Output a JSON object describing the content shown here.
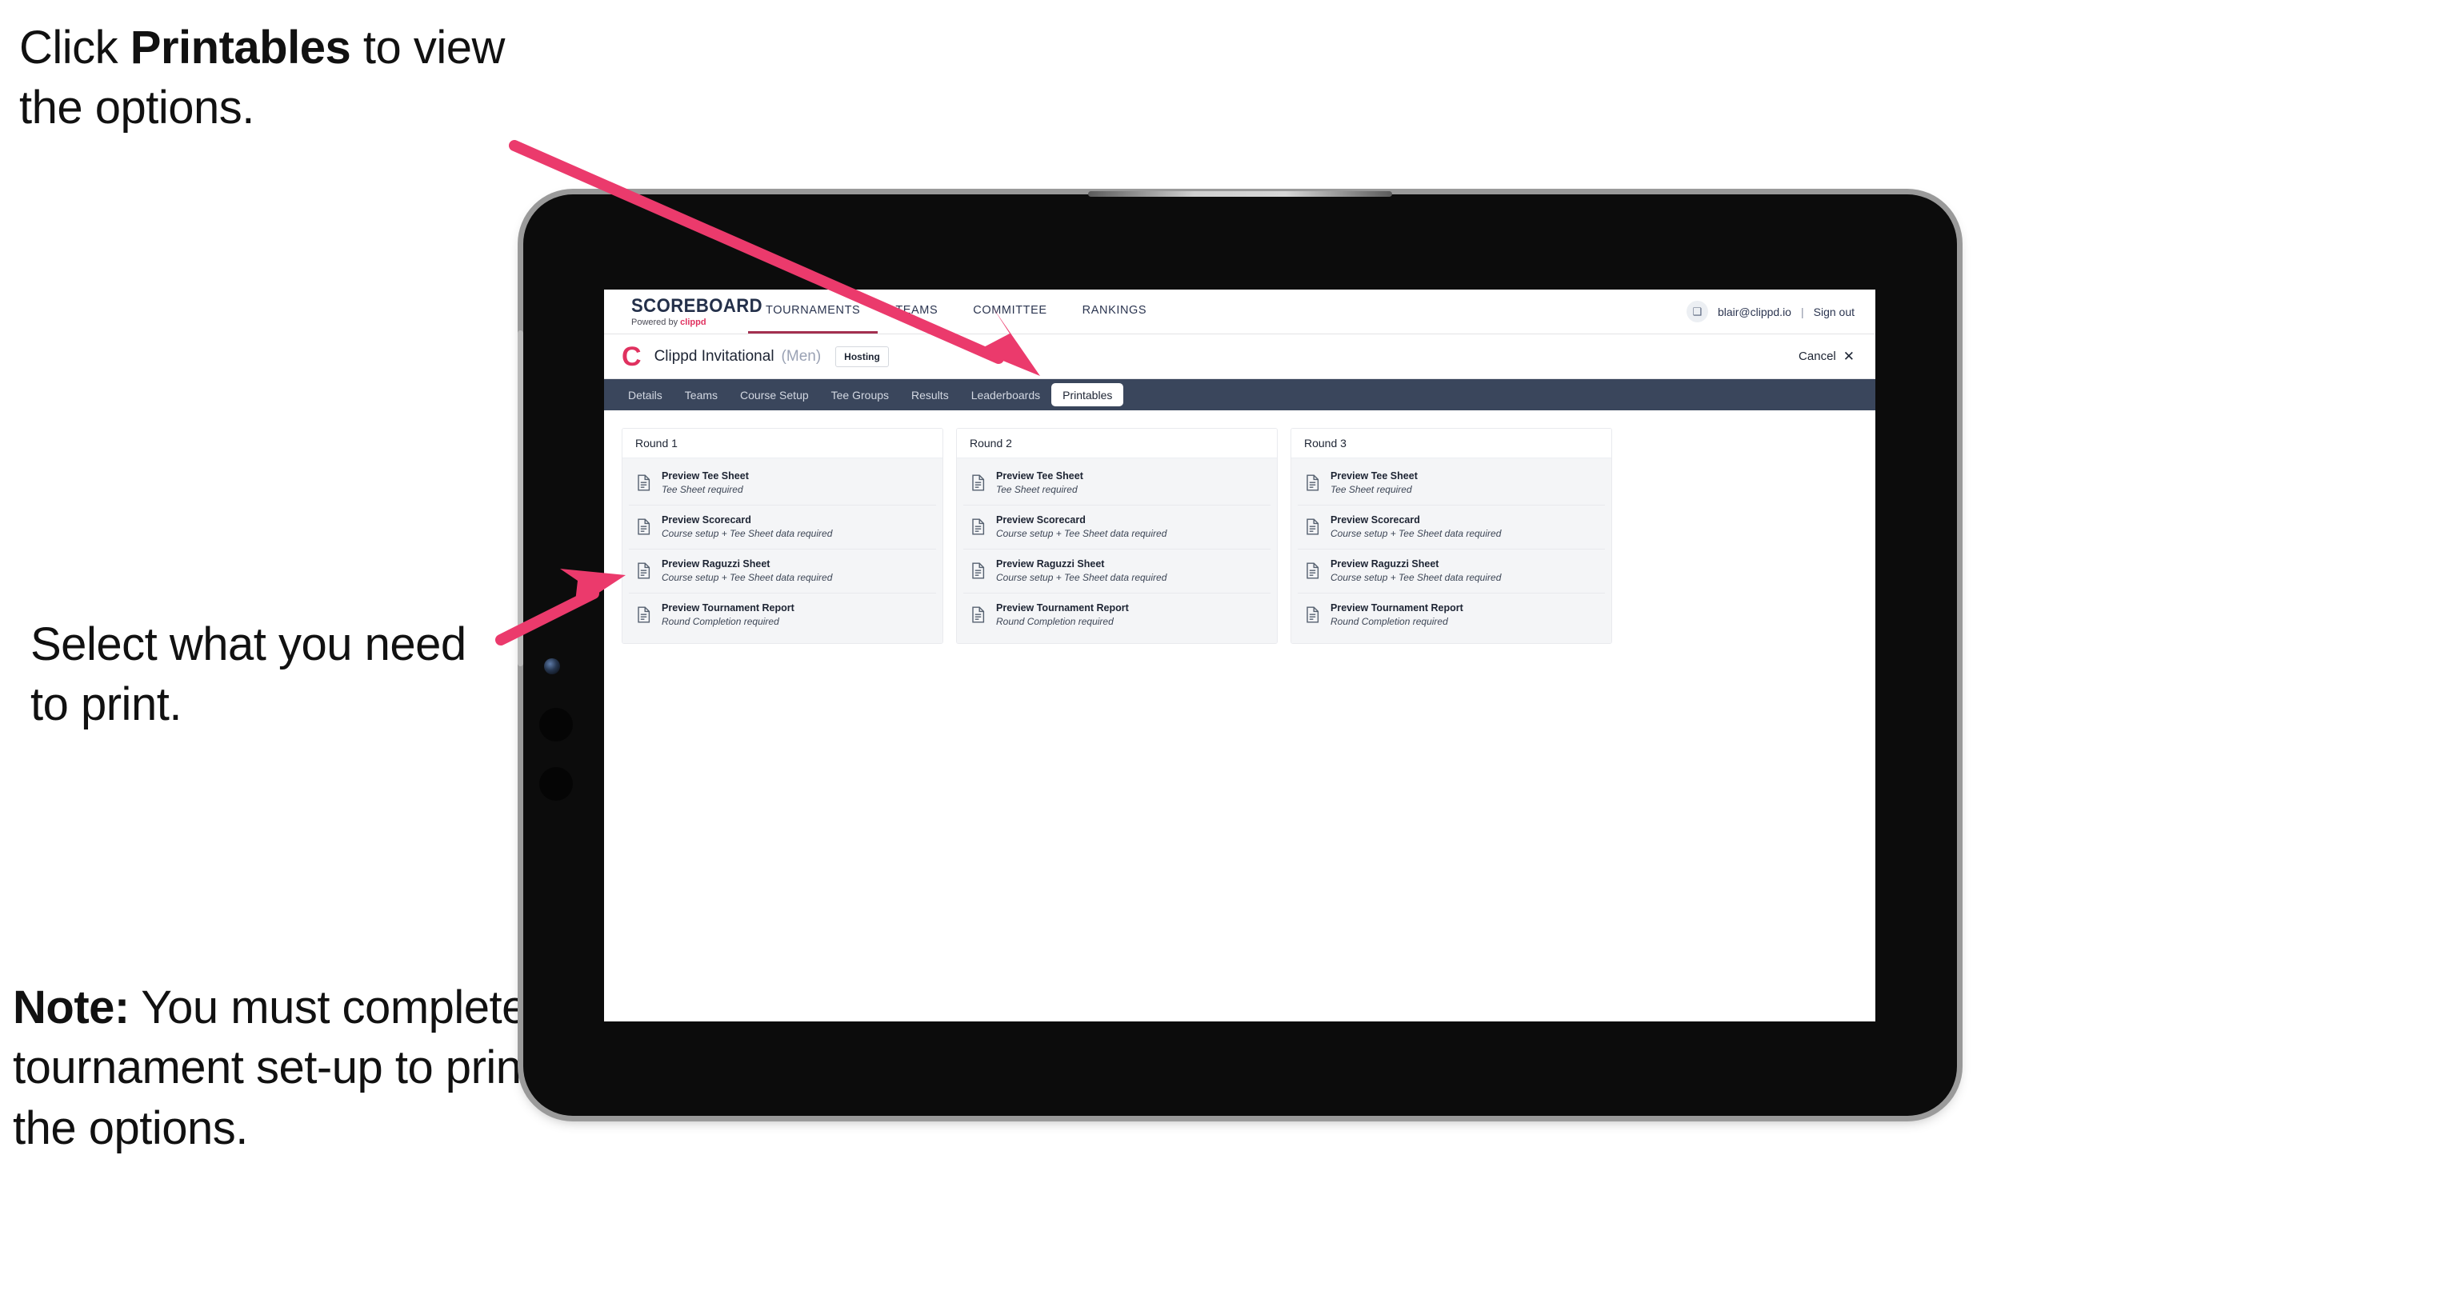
{
  "annotations": [
    {
      "id": "annot-1",
      "parts": [
        {
          "text": "Click ",
          "bold": false
        },
        {
          "text": "Printables",
          "bold": true
        },
        {
          "text": " to view the options.",
          "bold": false
        }
      ],
      "plain": "Click Printables to view the options."
    },
    {
      "id": "annot-2",
      "parts": [
        {
          "text": "Select what you need to print.",
          "bold": false
        }
      ],
      "plain": "Select what you need to print."
    },
    {
      "id": "annot-3",
      "parts": [
        {
          "text": "Note:",
          "bold": true
        },
        {
          "text": " You must complete the tournament set-up to print all the options.",
          "bold": false
        }
      ],
      "plain": "Note: You must complete the tournament set-up to print all the options."
    }
  ],
  "arrows": {
    "color": "#eb3a6c",
    "arrow_1_name": "arrow-to-printables-tab",
    "arrow_2_name": "arrow-to-printable-options"
  },
  "app": {
    "global_nav": {
      "brand_title": "SCOREBOARD",
      "brand_sub_prefix": "Powered by ",
      "brand_sub_name": "clippd",
      "items": [
        {
          "label": "TOURNAMENTS",
          "active": true
        },
        {
          "label": "TEAMS",
          "active": false
        },
        {
          "label": "COMMITTEE",
          "active": false
        },
        {
          "label": "RANKINGS",
          "active": false
        }
      ],
      "avatar_glyph": "❑",
      "user_email": "blair@clippd.io",
      "separator": "|",
      "sign_out": "Sign out"
    },
    "title_bar": {
      "logo_letter": "C",
      "tournament_name": "Clippd Invitational",
      "gender": "(Men)",
      "status_badge": "Hosting",
      "cancel_label": "Cancel",
      "cancel_icon": "✕"
    },
    "tabs": [
      {
        "label": "Details",
        "active": false
      },
      {
        "label": "Teams",
        "active": false
      },
      {
        "label": "Course Setup",
        "active": false
      },
      {
        "label": "Tee Groups",
        "active": false
      },
      {
        "label": "Results",
        "active": false
      },
      {
        "label": "Leaderboards",
        "active": false
      },
      {
        "label": "Printables",
        "active": true
      }
    ],
    "printables": {
      "rounds": [
        {
          "title": "Round 1",
          "items": [
            {
              "title": "Preview Tee Sheet",
              "subtitle": "Tee Sheet required"
            },
            {
              "title": "Preview Scorecard",
              "subtitle": "Course setup + Tee Sheet data required"
            },
            {
              "title": "Preview Raguzzi Sheet",
              "subtitle": "Course setup + Tee Sheet data required"
            },
            {
              "title": "Preview Tournament Report",
              "subtitle": "Round Completion required"
            }
          ]
        },
        {
          "title": "Round 2",
          "items": [
            {
              "title": "Preview Tee Sheet",
              "subtitle": "Tee Sheet required"
            },
            {
              "title": "Preview Scorecard",
              "subtitle": "Course setup + Tee Sheet data required"
            },
            {
              "title": "Preview Raguzzi Sheet",
              "subtitle": "Course setup + Tee Sheet data required"
            },
            {
              "title": "Preview Tournament Report",
              "subtitle": "Round Completion required"
            }
          ]
        },
        {
          "title": "Round 3",
          "items": [
            {
              "title": "Preview Tee Sheet",
              "subtitle": "Tee Sheet required"
            },
            {
              "title": "Preview Scorecard",
              "subtitle": "Course setup + Tee Sheet data required"
            },
            {
              "title": "Preview Raguzzi Sheet",
              "subtitle": "Course setup + Tee Sheet data required"
            },
            {
              "title": "Preview Tournament Report",
              "subtitle": "Round Completion required"
            }
          ]
        }
      ]
    }
  },
  "colors": {
    "accent_pink": "#e0315f",
    "annotation_arrow": "#eb3a6c",
    "tab_bar": "#3a465c",
    "brand_dark": "#24304a"
  }
}
